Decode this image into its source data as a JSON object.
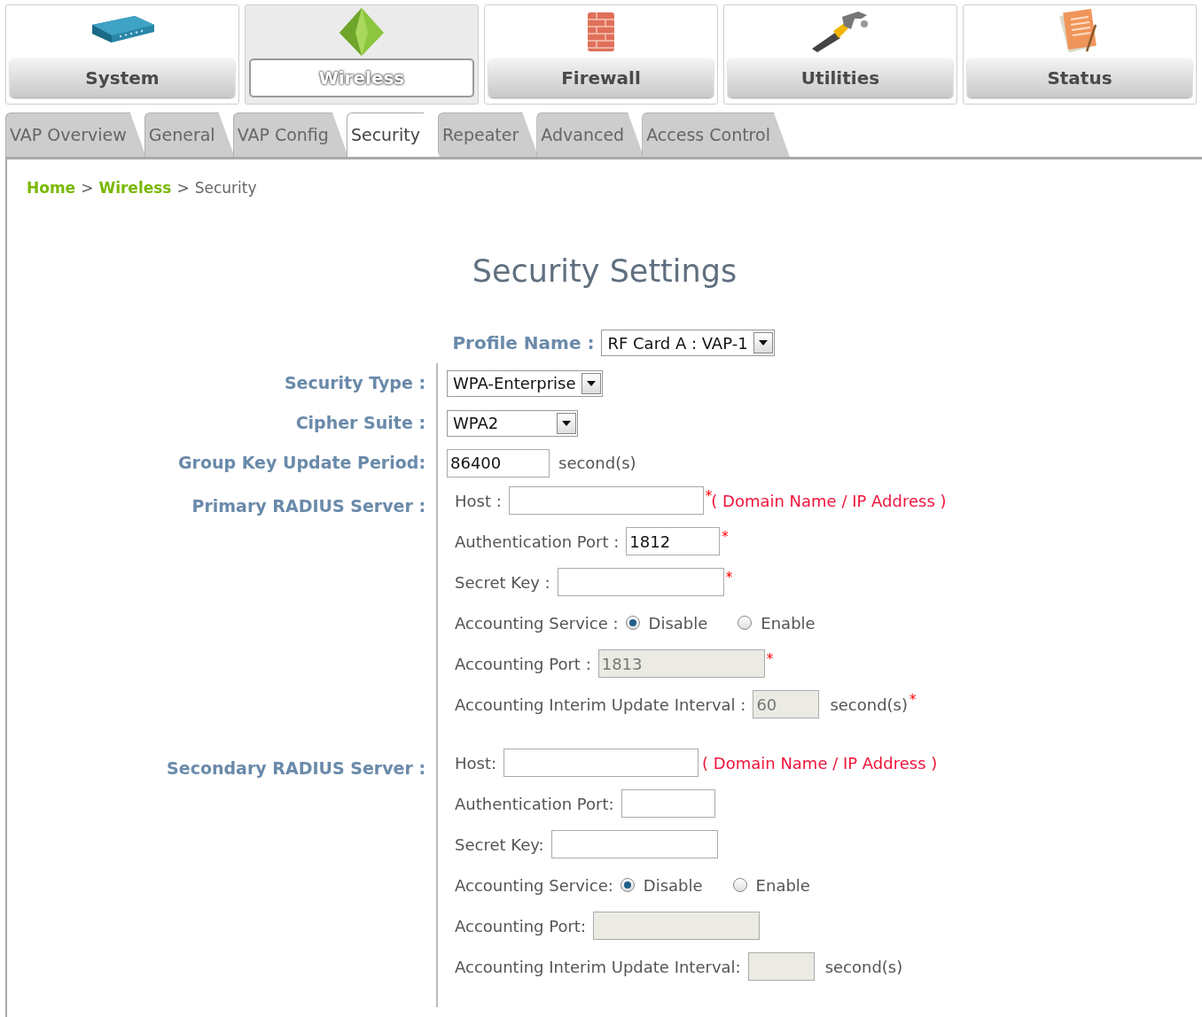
{
  "main_menu": [
    {
      "label": "System",
      "selected": false
    },
    {
      "label": "Wireless",
      "selected": true
    },
    {
      "label": "Firewall",
      "selected": false
    },
    {
      "label": "Utilities",
      "selected": false
    },
    {
      "label": "Status",
      "selected": false
    }
  ],
  "tabs": [
    {
      "label": "VAP Overview",
      "selected": false
    },
    {
      "label": "General",
      "selected": false
    },
    {
      "label": "VAP Config",
      "selected": false
    },
    {
      "label": "Security",
      "selected": true
    },
    {
      "label": "Repeater",
      "selected": false
    },
    {
      "label": "Advanced",
      "selected": false
    },
    {
      "label": "Access Control",
      "selected": false
    }
  ],
  "breadcrumb": [
    {
      "kind": "link",
      "label": "Home"
    },
    {
      "kind": "separator",
      "label": ">"
    },
    {
      "kind": "link",
      "label": "Wireless"
    },
    {
      "kind": "separator",
      "label": ">"
    },
    {
      "kind": "current",
      "label": "Security"
    }
  ],
  "title": "Security Settings",
  "profile": {
    "label": "Profile Name :",
    "value": "RF Card A : VAP-1"
  },
  "settings": [
    {
      "kind": "select",
      "label": "Security Type :",
      "value": "WPA-Enterprise"
    },
    {
      "kind": "select",
      "label": "Cipher Suite :",
      "value": "WPA2"
    },
    {
      "kind": "input",
      "label": "Group Key Update Period:",
      "value": "86400",
      "suffix": "second(s)"
    },
    {
      "kind": "group",
      "label": "Primary RADIUS Server :",
      "rows": [
        {
          "kind": "input",
          "label": "Host :",
          "disabled": false,
          "mark": "*",
          "note": "( Domain Name / IP Address )"
        },
        {
          "kind": "input",
          "label": "Authentication Port :",
          "value": "1812",
          "disabled": false,
          "mark": "*"
        },
        {
          "kind": "input",
          "label": "Secret Key :",
          "disabled": false,
          "mark": "*"
        },
        {
          "kind": "radio",
          "label": "Accounting Service :",
          "options": [
            {
              "label": "Disable",
              "selected": true
            },
            {
              "label": "Enable",
              "selected": false
            }
          ]
        },
        {
          "kind": "input",
          "label": "Accounting Port :",
          "value": "1813",
          "disabled": true,
          "mark": "*"
        },
        {
          "kind": "input",
          "label": "Accounting Interim Update Interval :",
          "value": "60",
          "disabled": true,
          "suffix": "second(s)",
          "mark": "*"
        }
      ]
    },
    {
      "kind": "group",
      "label": "Secondary RADIUS Server :",
      "rows": [
        {
          "kind": "input",
          "label": "Host:",
          "disabled": false,
          "note": "( Domain Name / IP Address )"
        },
        {
          "kind": "input",
          "label": "Authentication Port:",
          "disabled": false
        },
        {
          "kind": "input",
          "label": "Secret Key:",
          "disabled": false
        },
        {
          "kind": "radio",
          "label": "Accounting Service:",
          "options": [
            {
              "label": "Disable",
              "selected": true
            },
            {
              "label": "Enable",
              "selected": false
            }
          ]
        },
        {
          "kind": "input",
          "label": "Accounting Port:",
          "disabled": true
        },
        {
          "kind": "input",
          "label": "Accounting Interim Update Interval:",
          "disabled": true,
          "suffix": "second(s)"
        }
      ]
    }
  ]
}
